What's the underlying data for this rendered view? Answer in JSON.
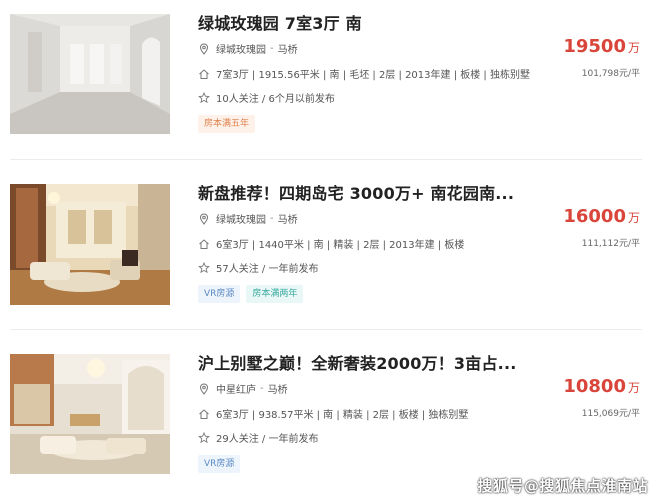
{
  "listings": [
    {
      "title": "绿城玫瑰园 7室3厅 南",
      "community": "绿城玫瑰园",
      "area": "马桥",
      "info": "7室3厅 | 1915.56平米 | 南 | 毛坯 | 2层 | 2013年建 | 板楼 | 独栋别墅",
      "follow": "10人关注 / 6个月以前发布",
      "tags": [
        "房本满五年"
      ],
      "price": "19500",
      "price_unit": "万",
      "unit_price": "101,798元/平",
      "image": "empty-villa-interior"
    },
    {
      "title": "新盘推荐！四期岛宅 3000万+ 南花园南...",
      "community": "绿城玫瑰园",
      "area": "马桥",
      "info": "6室3厅 | 1440平米 | 南 | 精装 | 2层 | 2013年建 | 板楼",
      "follow": "57人关注 / 一年前发布",
      "tags": [
        "VR房源",
        "房本满两年"
      ],
      "price": "16000",
      "price_unit": "万",
      "unit_price": "111,112元/平",
      "image": "furnished-living-room"
    },
    {
      "title": "沪上别墅之巅！全新奢装2000万！3亩占...",
      "community": "中星红庐",
      "area": "马桥",
      "info": "6室3厅 | 938.57平米 | 南 | 精装 | 2层 | 板楼 | 独栋别墅",
      "follow": "29人关注 / 一年前发布",
      "tags": [
        "VR房源"
      ],
      "price": "10800",
      "price_unit": "万",
      "unit_price": "115,069元/平",
      "image": "luxury-hall"
    }
  ],
  "separator": "-",
  "watermark": "搜狐号@搜狐焦点淮南站",
  "colors": {
    "price": "#d9453a",
    "tag_blue": "#5b8ac5",
    "tag_teal": "#3aa99f",
    "tag_orange": "#e0824e"
  }
}
